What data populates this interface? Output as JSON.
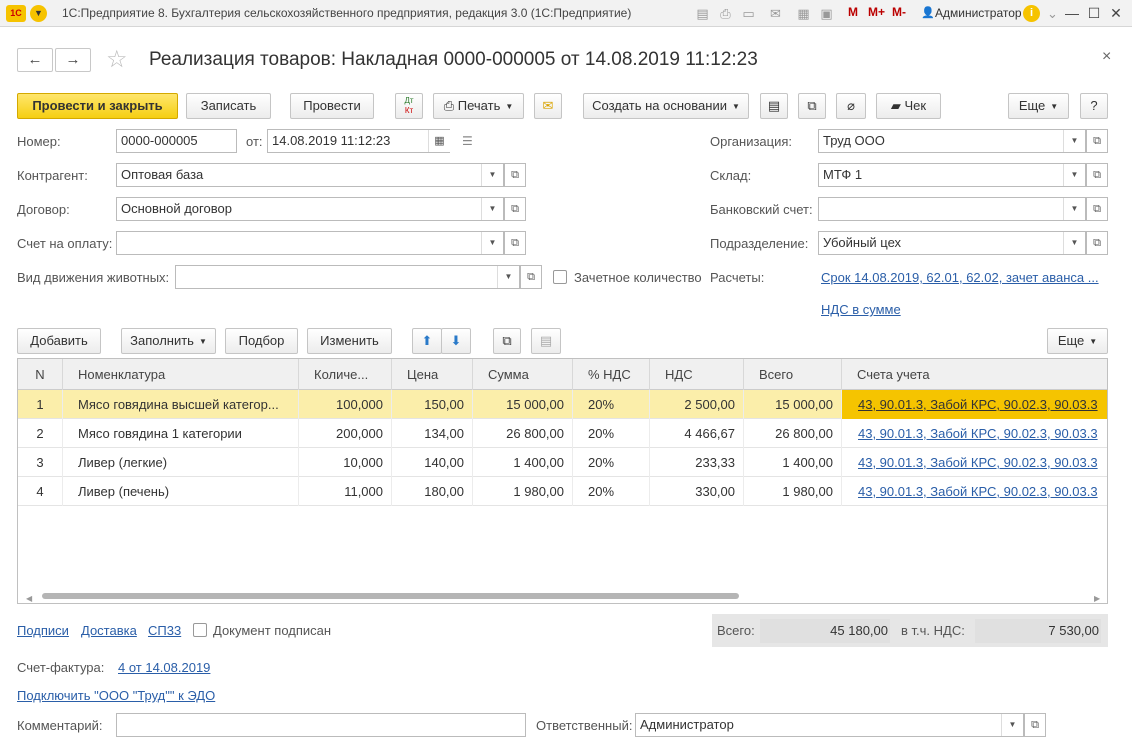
{
  "app": {
    "title": "1С:Предприятие 8. Бухгалтерия сельскохозяйственного предприятия, редакция 3.0  (1С:Предприятие)",
    "user": "Администратор",
    "m_labels": [
      "M",
      "M+",
      "M-"
    ]
  },
  "header": {
    "doc_title": "Реализация товаров: Накладная 0000-000005 от 14.08.2019 11:12:23",
    "back": "←",
    "forward": "→",
    "star": "☆",
    "close": "×"
  },
  "toolbar": {
    "post_close": "Провести и закрыть",
    "save": "Записать",
    "post": "Провести",
    "dt_kt_top": "Дт",
    "dt_kt_bottom": "Кт",
    "print": "Печать",
    "create_based": "Создать на основании",
    "check": "Чек",
    "more": "Еще",
    "help": "?"
  },
  "form": {
    "number_label": "Номер:",
    "number_value": "0000-000005",
    "date_label": "от:",
    "date_value": "14.08.2019 11:12:23",
    "contractor_label": "Контрагент:",
    "contractor_value": "Оптовая база",
    "contract_label": "Договор:",
    "contract_value": "Основной договор",
    "invoice_label": "Счет на оплату:",
    "invoice_value": "",
    "animal_move_label": "Вид движения животных:",
    "animal_move_value": "",
    "offset_qty_label": "Зачетное количество",
    "org_label": "Организация:",
    "org_value": "Труд ООО",
    "warehouse_label": "Склад:",
    "warehouse_value": "МТФ 1",
    "bank_label": "Банковский счет:",
    "bank_value": "",
    "division_label": "Подразделение:",
    "division_value": "Убойный цех",
    "settlements_label": "Расчеты:",
    "settlements_link": "Срок 14.08.2019, 62.01, 62.02, зачет аванса ...",
    "vat_link": "НДС в сумме"
  },
  "table_toolbar": {
    "add": "Добавить",
    "fill": "Заполнить",
    "pick": "Подбор",
    "change": "Изменить",
    "more": "Еще"
  },
  "table": {
    "headers": [
      "N",
      "Номенклатура",
      "Количе...",
      "Цена",
      "Сумма",
      "% НДС",
      "НДС",
      "Всего",
      "Счета учета"
    ],
    "rows": [
      [
        "1",
        "Мясо говядина высшей категор...",
        "100,000",
        "150,00",
        "15 000,00",
        "20%",
        "2 500,00",
        "15 000,00",
        "43, 90.01.3, Забой КРС, 90.02.3, 90.03.3"
      ],
      [
        "2",
        "Мясо говядина 1 категории",
        "200,000",
        "134,00",
        "26 800,00",
        "20%",
        "4 466,67",
        "26 800,00",
        "43, 90.01.3, Забой КРС, 90.02.3, 90.03.3"
      ],
      [
        "3",
        "Ливер (легкие)",
        "10,000",
        "140,00",
        "1 400,00",
        "20%",
        "233,33",
        "1 400,00",
        "43, 90.01.3, Забой КРС, 90.02.3, 90.03.3"
      ],
      [
        "4",
        "Ливер (печень)",
        "11,000",
        "180,00",
        "1 980,00",
        "20%",
        "330,00",
        "1 980,00",
        "43, 90.01.3, Забой КРС, 90.02.3, 90.03.3"
      ]
    ]
  },
  "footer": {
    "signatures": "Подписи",
    "delivery": "Доставка",
    "sp33": "СП33",
    "signed_label": "Документ подписан",
    "total_label": "Всего:",
    "total_value": "45 180,00",
    "vat_label": "в т.ч. НДС:",
    "vat_value": "7 530,00",
    "invoice_label": "Счет-фактура:",
    "invoice_link": "4 от 14.08.2019",
    "edo_link": "Подключить \"ООО \"Труд\"\" к ЭДО",
    "comment_label": "Комментарий:",
    "comment_value": "",
    "responsible_label": "Ответственный:",
    "responsible_value": "Администратор"
  }
}
